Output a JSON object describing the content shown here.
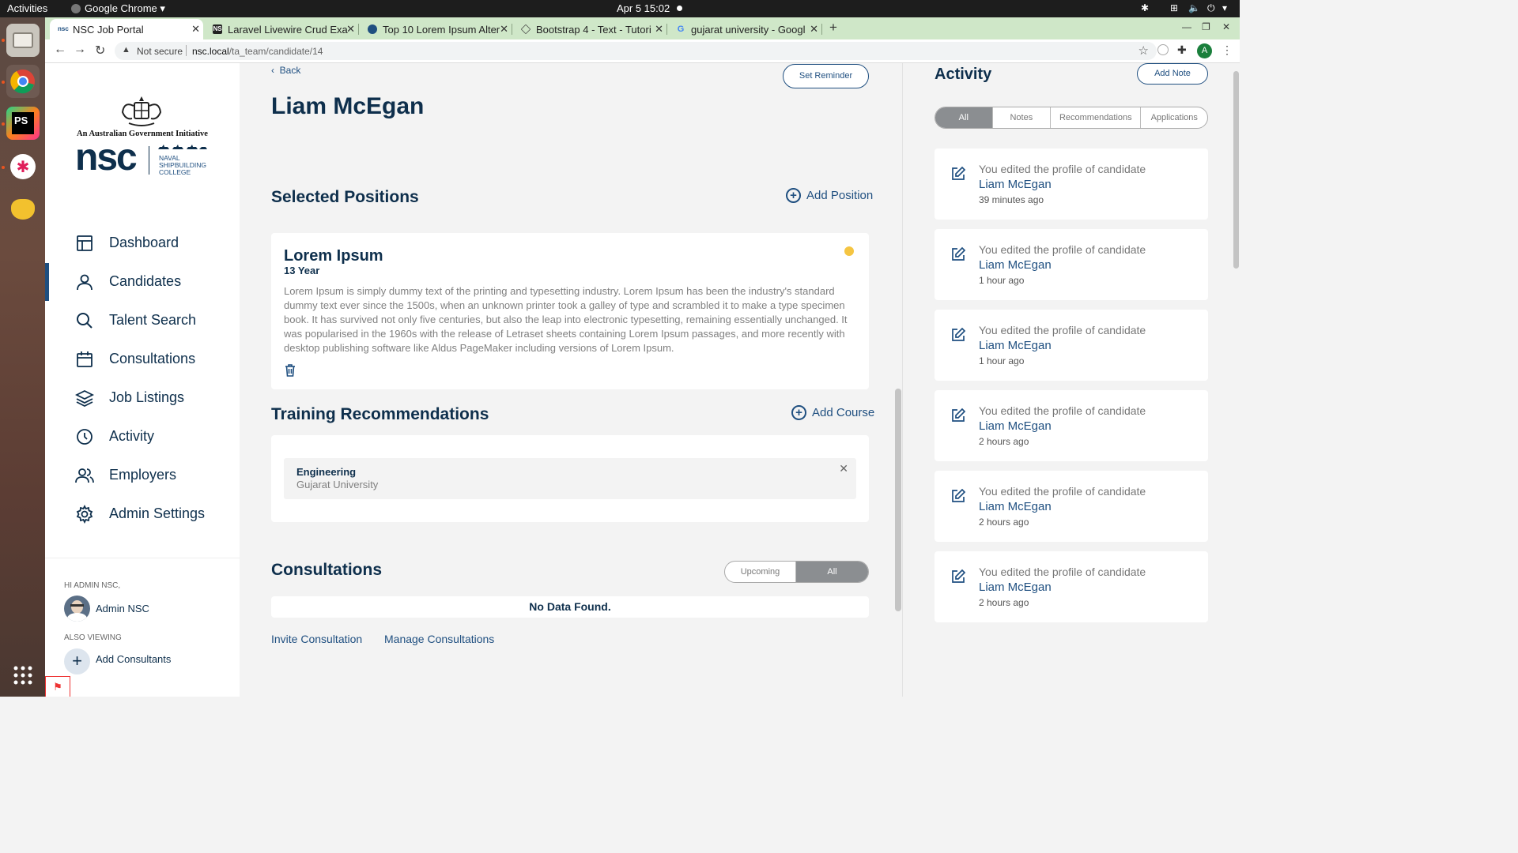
{
  "system_bar": {
    "activities": "Activities",
    "app": "Google Chrome ▾",
    "clock": "Apr 5  15:02"
  },
  "tabs": [
    {
      "title": "NSC Job Portal",
      "favicon": "nsc"
    },
    {
      "title": "Laravel Livewire Crud Exa",
      "favicon": "ns"
    },
    {
      "title": "Top 10 Lorem Ipsum Alter",
      "favicon": "circle"
    },
    {
      "title": "Bootstrap 4 - Text - Tutori",
      "favicon": "diamond"
    },
    {
      "title": "gujarat university - Googl",
      "favicon": "google"
    }
  ],
  "address": {
    "security": "Not secure",
    "domain": "nsc.local",
    "path": "/ta_team/candidate/14",
    "profile_initial": "A"
  },
  "logo": {
    "initiative": "An Australian Government Initiative",
    "nsc": "nsc",
    "college_line1": "NAVAL",
    "college_line2": "SHIPBUILDING",
    "college_line3": "COLLEGE"
  },
  "nav": [
    {
      "label": "Dashboard",
      "icon": "dashboard-icon"
    },
    {
      "label": "Candidates",
      "icon": "person-icon",
      "active": true
    },
    {
      "label": "Talent Search",
      "icon": "search-icon"
    },
    {
      "label": "Consultations",
      "icon": "calendar-icon"
    },
    {
      "label": "Job Listings",
      "icon": "layers-icon"
    },
    {
      "label": "Activity",
      "icon": "clock-icon"
    },
    {
      "label": "Employers",
      "icon": "people-icon"
    },
    {
      "label": "Admin Settings",
      "icon": "gear-icon"
    }
  ],
  "user": {
    "greeting": "HI ADMIN NSC,",
    "name": "Admin NSC",
    "also_viewing": "ALSO VIEWING",
    "add_consultants": "Add Consultants"
  },
  "main": {
    "back": "Back",
    "set_reminder": "Set Reminder",
    "candidate_name": "Liam McEgan",
    "positions_title": "Selected Positions",
    "add_position": "Add Position",
    "position": {
      "title": "Lorem Ipsum",
      "experience": "13 Year",
      "description": "Lorem Ipsum is simply dummy text of the printing and typesetting industry. Lorem Ipsum has been the industry's standard dummy text ever since the 1500s, when an unknown printer took a galley of type and scrambled it to make a type specimen book. It has survived not only five centuries, but also the leap into electronic typesetting, remaining essentially unchanged. It was popularised in the 1960s with the release of Letraset sheets containing Lorem Ipsum passages, and more recently with desktop publishing software like Aldus PageMaker including versions of Lorem Ipsum.",
      "status_color": "#f5c542"
    },
    "training_title": "Training Recommendations",
    "add_course": "Add Course",
    "course": {
      "name": "Engineering",
      "institution": "Gujarat University"
    },
    "consultations_title": "Consultations",
    "consult_filters": [
      "Upcoming",
      "All"
    ],
    "consult_filter_selected": "All",
    "no_data": "No Data Found.",
    "invite": "Invite Consultation",
    "manage": "Manage Consultations"
  },
  "activity": {
    "title": "Activity",
    "add_note": "Add Note",
    "filters": [
      "All",
      "Notes",
      "Recommendations",
      "Applications"
    ],
    "filter_selected": "All",
    "items": [
      {
        "text": "You edited the profile of candidate",
        "name": "Liam McEgan",
        "time": "39 minutes ago"
      },
      {
        "text": "You edited the profile of candidate",
        "name": "Liam McEgan",
        "time": "1 hour ago"
      },
      {
        "text": "You edited the profile of candidate",
        "name": "Liam McEgan",
        "time": "1 hour ago"
      },
      {
        "text": "You edited the profile of candidate",
        "name": "Liam McEgan",
        "time": "2 hours ago"
      },
      {
        "text": "You edited the profile of candidate",
        "name": "Liam McEgan",
        "time": "2 hours ago"
      },
      {
        "text": "You edited the profile of candidate",
        "name": "Liam McEgan",
        "time": "2 hours ago"
      }
    ]
  },
  "colors": {
    "brand": "#1f4f80",
    "text_dark": "#0e2f4c",
    "tab_strip": "#cfe7c8"
  }
}
